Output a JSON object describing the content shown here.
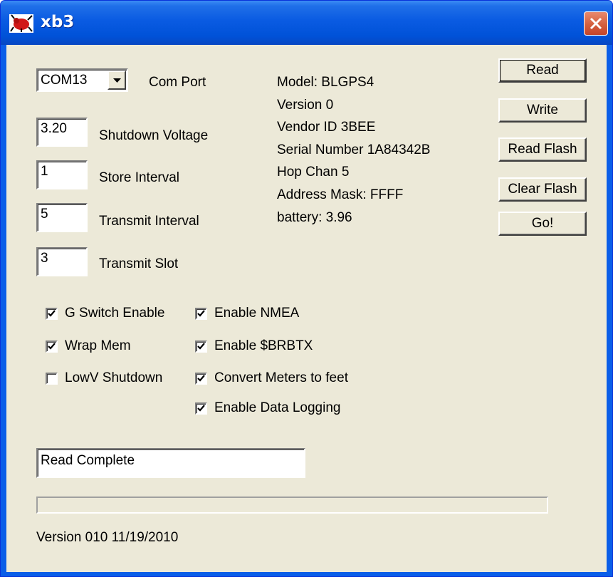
{
  "window": {
    "title": "xb3",
    "icon": "bug-app-icon",
    "close_icon": "close-x-icon"
  },
  "com_port": {
    "selected": "COM13",
    "label": "Com Port"
  },
  "fields": [
    {
      "label": "Shutdown Voltage",
      "value": "3.20"
    },
    {
      "label": "Store Interval",
      "value": "1"
    },
    {
      "label": "Transmit Interval",
      "value": "5"
    },
    {
      "label": "Transmit Slot",
      "value": "3"
    }
  ],
  "device_info": [
    "Model: BLGPS4",
    "Version 0",
    "Vendor ID 3BEE",
    "Serial Number 1A84342B",
    "Hop Chan 5",
    "Address Mask: FFFF",
    "battery: 3.96"
  ],
  "buttons": [
    "Read",
    "Write",
    "Read Flash",
    "Clear Flash",
    "Go!"
  ],
  "checkboxes_left": [
    {
      "label": "G Switch Enable",
      "checked": true
    },
    {
      "label": "Wrap Mem",
      "checked": true
    },
    {
      "label": "LowV Shutdown",
      "checked": false
    }
  ],
  "checkboxes_right": [
    {
      "label": "Enable NMEA",
      "checked": true
    },
    {
      "label": "Enable $BRBTX",
      "checked": true
    },
    {
      "label": "Convert Meters to feet",
      "checked": true
    },
    {
      "label": "Enable Data Logging",
      "checked": true
    }
  ],
  "status": "Read Complete",
  "progress": 0,
  "version_text": "Version 010 11/19/2010",
  "colors": {
    "titlebar": "#0a5ee8",
    "face": "#ece9d8",
    "close": "#d45f3e"
  }
}
